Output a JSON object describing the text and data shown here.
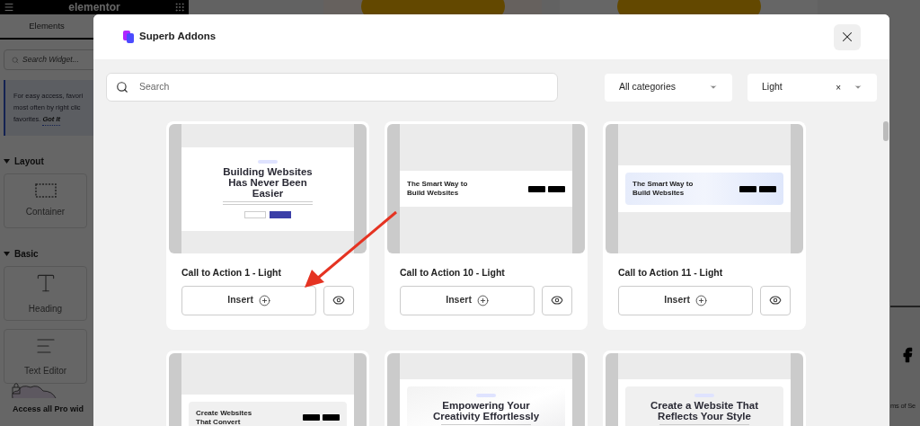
{
  "editor": {
    "brand": "elementor",
    "tab": {
      "label": "Elements",
      "selected": true
    },
    "search": {
      "placeholder": "Search Widget..."
    },
    "tip": {
      "lines": [
        "For easy access, favori",
        "most often by right clic",
        "favorites."
      ],
      "link": "Got It"
    },
    "sections": [
      {
        "title": "Layout",
        "expanded": true,
        "widgets": [
          {
            "label": "Container",
            "kind": "container"
          }
        ]
      },
      {
        "title": "Basic",
        "expanded": true,
        "widgets": [
          {
            "label": "Heading",
            "kind": "heading"
          },
          {
            "label": "Text Editor",
            "kind": "text"
          }
        ]
      }
    ],
    "promo": "Access all Pro wid"
  },
  "page_behind": {
    "footer_text": "ms of Se"
  },
  "modal": {
    "title": "Superb Addons",
    "search": {
      "placeholder": "Search"
    },
    "filters": [
      {
        "value": "All categories",
        "clearable": false
      },
      {
        "value": "Light",
        "clearable": true
      }
    ],
    "clear_symbol": "×",
    "templates": [
      {
        "name": "Call to Action 1 - Light",
        "insert": "Insert",
        "preview": {
          "kind": "centered",
          "heading": "Building Websites Has Never Been Easier"
        }
      },
      {
        "name": "Call to Action 10 - Light",
        "insert": "Insert",
        "preview": {
          "kind": "split",
          "heading": "The Smart Way to Build Websites"
        }
      },
      {
        "name": "Call to Action 11 - Light",
        "insert": "Insert",
        "preview": {
          "kind": "gradient",
          "heading": "The Smart Way to Build Websites"
        }
      },
      {
        "preview": {
          "kind": "boxed",
          "heading": "Create Websites That Convert"
        }
      },
      {
        "preview": {
          "kind": "marble",
          "heading": "Empowering Your Creativity Effortlessly"
        }
      },
      {
        "preview": {
          "kind": "panel",
          "heading": "Create a Website That Reflects Your Style"
        }
      }
    ]
  }
}
